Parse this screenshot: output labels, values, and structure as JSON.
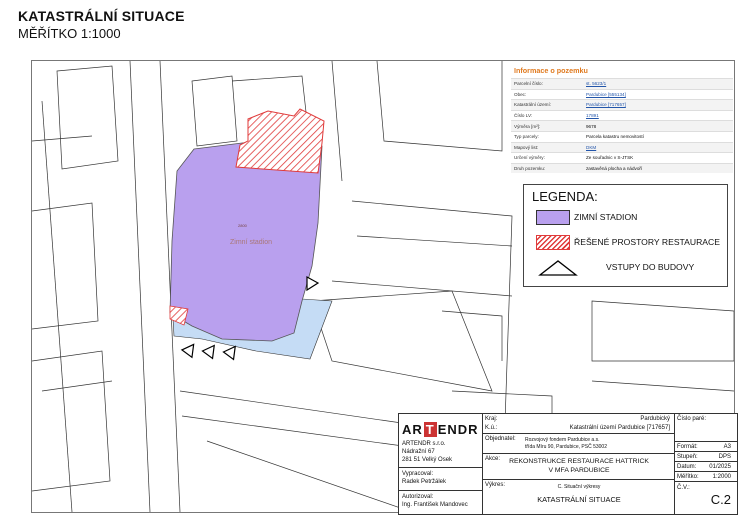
{
  "header": {
    "title": "KATASTRÁLNÍ SITUACE",
    "scale": "MĚŘÍTKO 1:1000"
  },
  "map": {
    "building_label": "Zimní stadion",
    "building_code": "2800"
  },
  "info_panel": {
    "title": "Informace o pozemku",
    "rows": [
      {
        "key": "Parcelní číslo:",
        "value": "st. 5623/1",
        "link": true
      },
      {
        "key": "Obec:",
        "value": "Pardubice [555134]",
        "link": true
      },
      {
        "key": "Katastrální území:",
        "value": "Pardubice [717657]",
        "link": true
      },
      {
        "key": "Číslo LV:",
        "value": "17891",
        "link": true
      },
      {
        "key": "Výměra [m²]:",
        "value": "9678",
        "link": false
      },
      {
        "key": "Typ parcely:",
        "value": "Parcela katastru nemovitostí",
        "link": false
      },
      {
        "key": "Mapový list:",
        "value": "DKM",
        "link": true
      },
      {
        "key": "Určení výměry:",
        "value": "Ze souřadnic v S-JTSK",
        "link": false
      },
      {
        "key": "Druh pozemku:",
        "value": "zastavěná plocha a nádvoří",
        "link": false
      }
    ]
  },
  "legend": {
    "title": "LEGENDA:",
    "items": [
      {
        "label": "ZIMNÍ STADION",
        "color": "#b9a0ee"
      },
      {
        "label": "ŘEŠENÉ PROSTORY RESTAURACE",
        "color": "#e03a3a"
      },
      {
        "label": "VSTUPY DO BUDOVY",
        "color": "#000000"
      }
    ]
  },
  "title_block": {
    "logo_a": "AR",
    "logo_b": "T",
    "logo_c": "ENDR",
    "company": "ARTENDR s.r.o.",
    "street": "Nádražní 67",
    "city": "281 51 Velký Osek",
    "drawn_by_label": "Vypracoval:",
    "drawn_by": "Radek Petržálek",
    "author_label": "Autorizoval:",
    "author": "Ing. František Mandovec",
    "kraj_label": "Kraj:",
    "kraj_value": "Pardubický",
    "ku_label": "K.ú.:",
    "ku_value": "Katastrální území Pardubice [717657]",
    "cislo_pare_label": "Číslo paré:",
    "client_label": "Objednatel:",
    "client_line1": "Rozvojový fondem Pardubice a.s.",
    "client_line2": "třída Míru 90, Pardubice, PSČ 53002",
    "akce_label": "Akce:",
    "akce_line1": "REKONSTRUKCE RESTAURACE HATTRICK",
    "akce_line2": "V MFA PARDUBICE",
    "vykres_label": "Výkres:",
    "vykres_small": "C. Situační výkresy",
    "vykres_title": "KATASTRÁLNÍ SITUACE",
    "format_label": "Formát:",
    "format_value": "A3",
    "stupen_label": "Stupeň:",
    "stupen_value": "DPS",
    "datum_label": "Datum:",
    "datum_value": "01/2025",
    "meritko_label": "Měřítko:",
    "meritko_value": "1:2000",
    "cv_label": "Č.V.:",
    "cv_value": "C.2"
  }
}
